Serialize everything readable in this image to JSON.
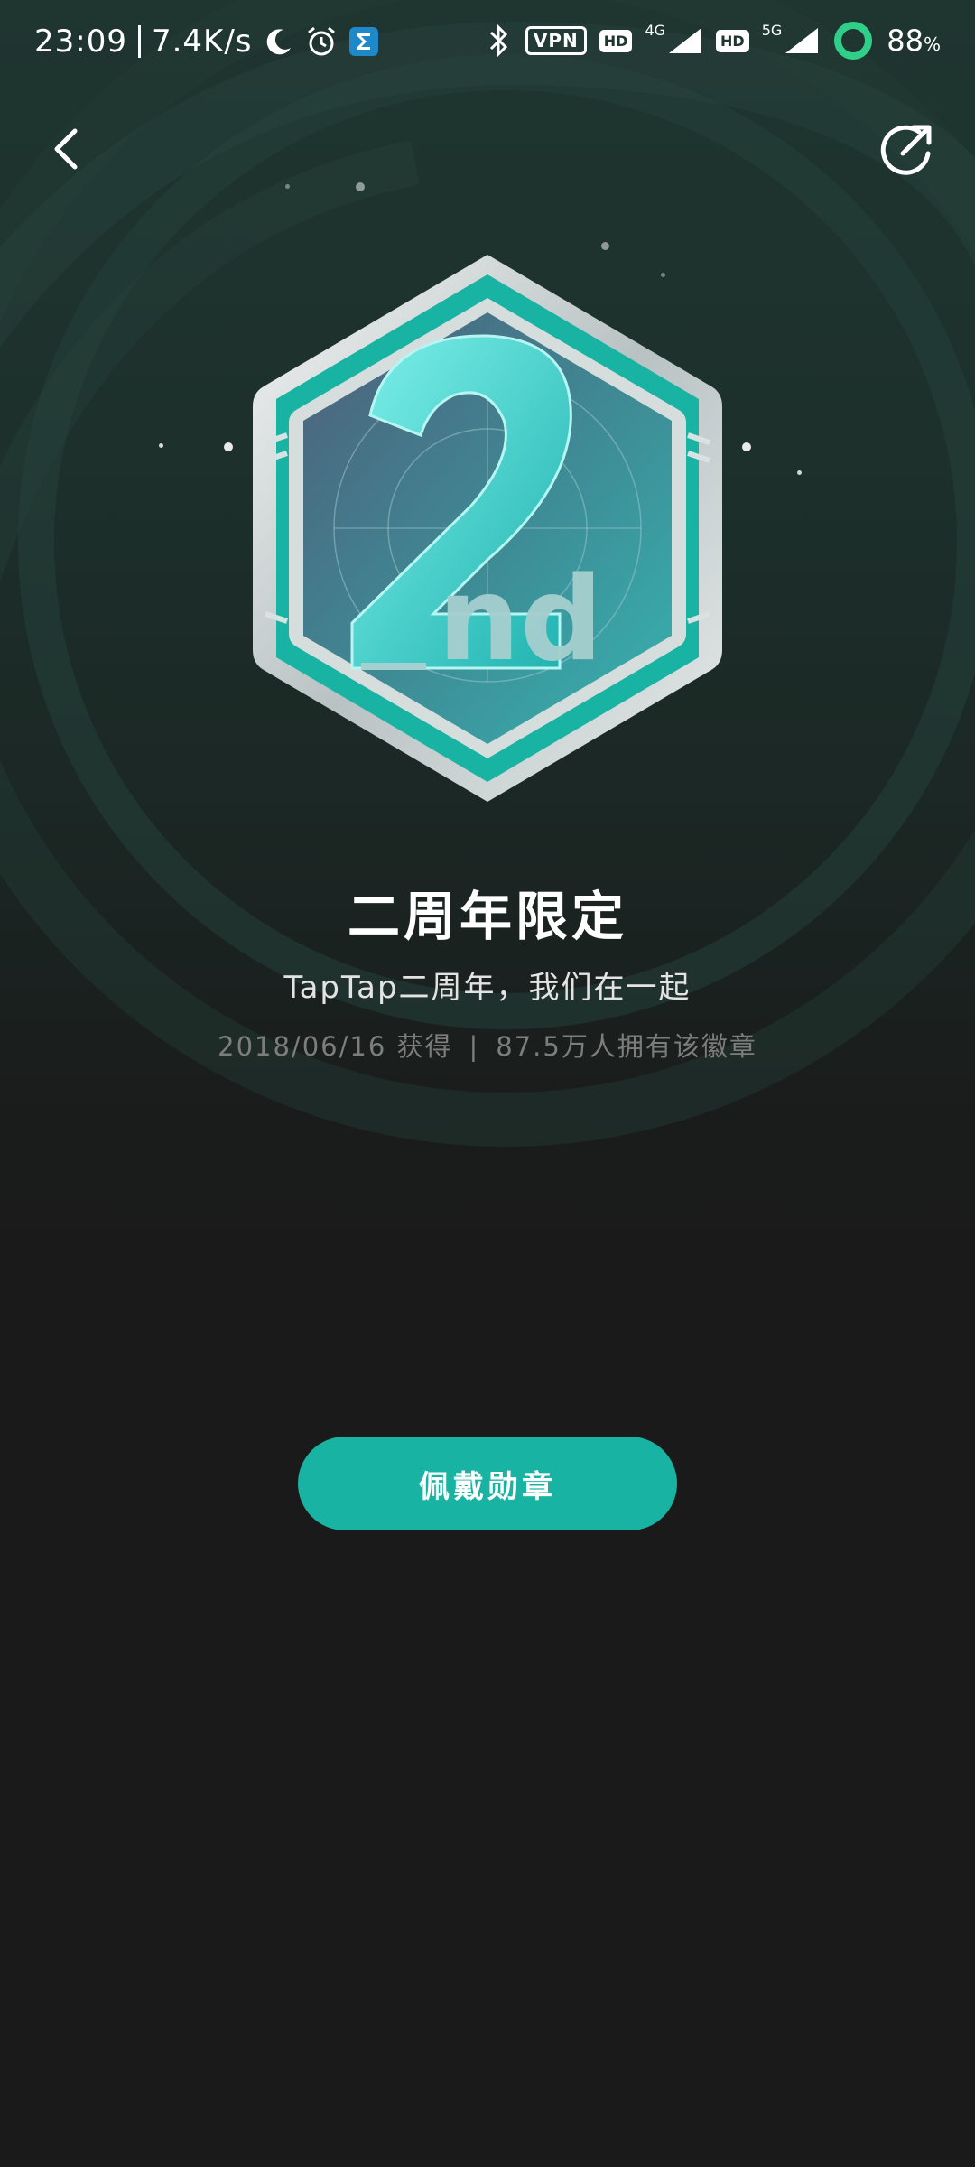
{
  "status_bar": {
    "time": "23:09",
    "net_speed": "7.4K/s",
    "vpn_label": "VPN",
    "hd1": "HD",
    "net1": "4G",
    "hd2": "HD",
    "net2": "5G",
    "battery": "88",
    "battery_unit": "%"
  },
  "nav": {
    "back_icon": "chevron-left-icon",
    "share_icon": "share-icon"
  },
  "badge": {
    "numeral": "2",
    "suffix": "nd",
    "accent_color": "#19b3a3"
  },
  "title": "二周年限定",
  "subtitle": "TapTap二周年，我们在一起",
  "meta": {
    "date": "2018/06/16 获得",
    "divider": "|",
    "owners": "87.5万人拥有该徽章"
  },
  "wear_button": {
    "label": "佩戴勋章",
    "color": "#19b3a3"
  }
}
